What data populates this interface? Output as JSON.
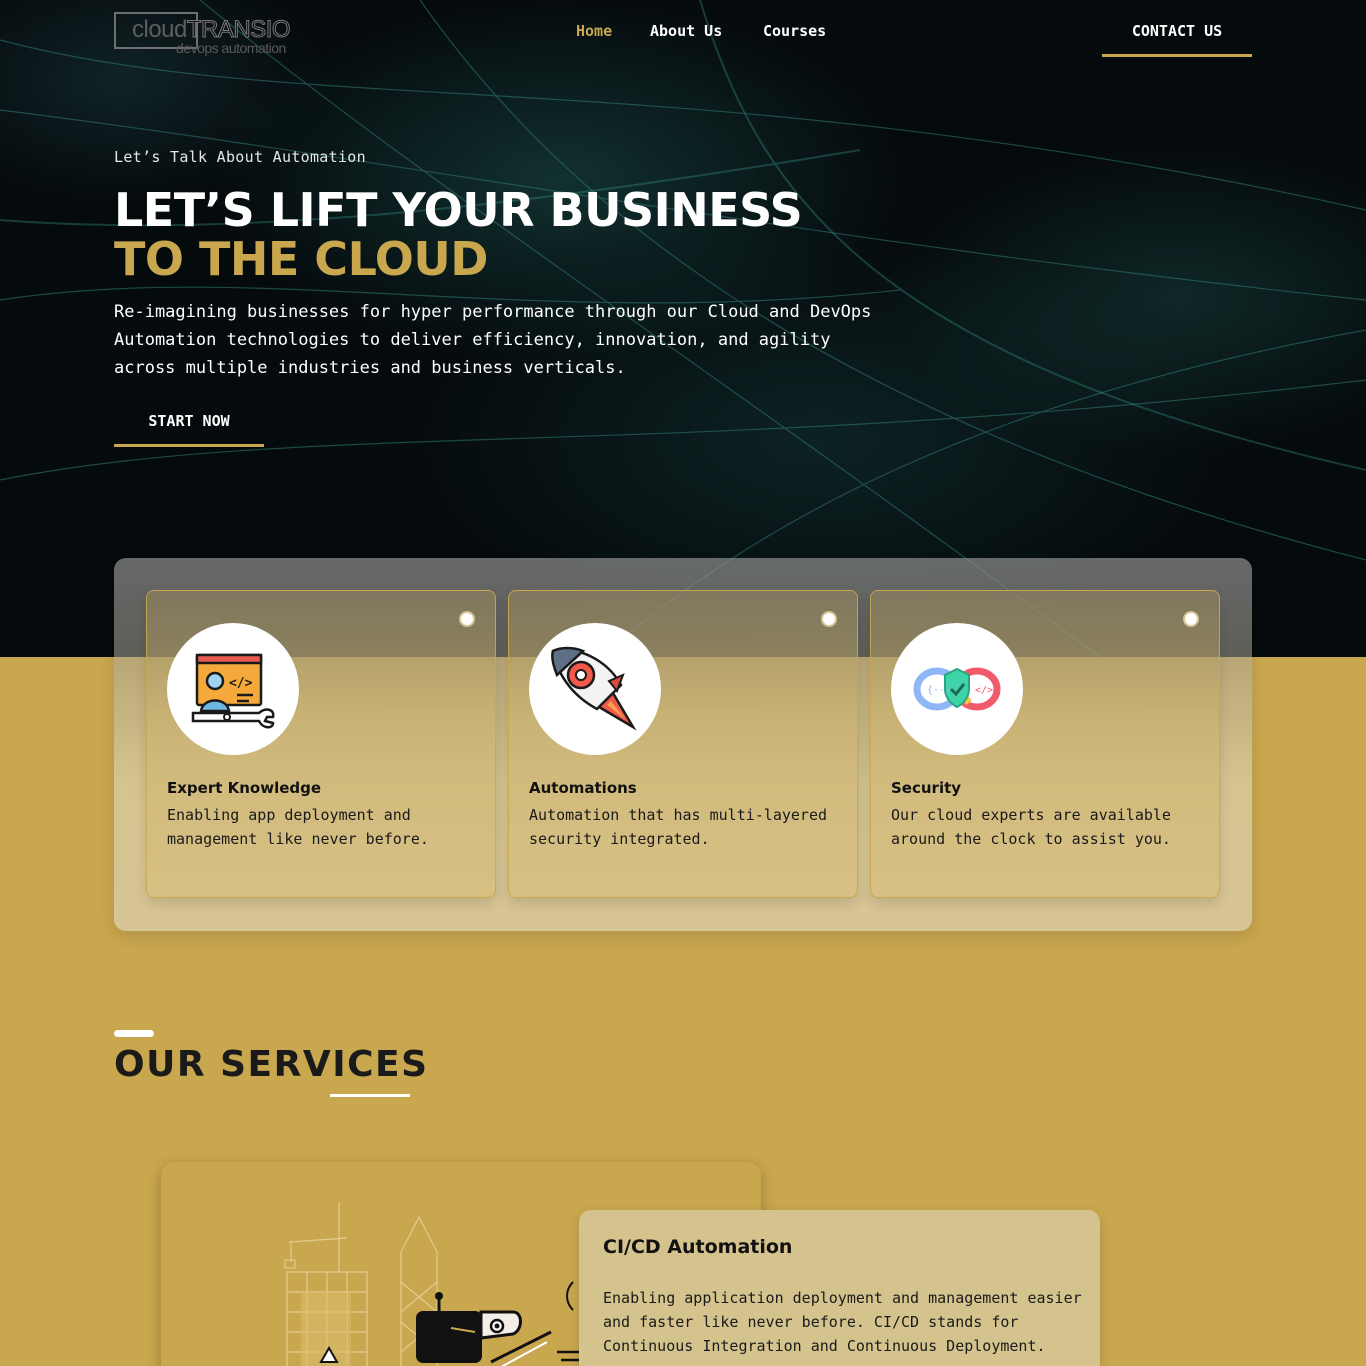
{
  "brand": {
    "logo_word_a": "cloud",
    "logo_word_b": "TRANSIO",
    "logo_tagline": "devops automation"
  },
  "nav": {
    "items": [
      {
        "label": "Home",
        "active": true
      },
      {
        "label": "About Us",
        "active": false
      },
      {
        "label": "Courses",
        "active": false
      }
    ],
    "contact_label": "CONTACT US"
  },
  "hero": {
    "eyebrow": "Let’s Talk About Automation",
    "headline_line1": "LET’S LIFT YOUR BUSINESS",
    "headline_line2": "TO THE CLOUD",
    "lead": "Re-imagining businesses for hyper performance through our Cloud and DevOps Automation technologies to deliver efficiency, innovation, and agility across multiple industries and business verticals.",
    "cta_label": "START NOW"
  },
  "features": [
    {
      "icon": "developer-wrench-icon",
      "title": "Expert Knowledge",
      "desc": "Enabling app deployment and management like never before."
    },
    {
      "icon": "rocket-gear-icon",
      "title": "Automations",
      "desc": "Automation that has multi-layered security integrated."
    },
    {
      "icon": "devops-shield-icon",
      "title": "Security",
      "desc": "Our cloud experts are available around the clock to assist you."
    }
  ],
  "services": {
    "heading": "OUR SERVICES",
    "items": [
      {
        "title": "CI/CD Automation",
        "desc": "Enabling application deployment and management easier and faster like never before. CI/CD stands for Continuous Integration and Continuous Deployment."
      }
    ]
  },
  "colors": {
    "accent": "#c9a74e",
    "hero_bg": "#050a0d",
    "text_dark": "#1a1a1a",
    "white": "#ffffff"
  }
}
